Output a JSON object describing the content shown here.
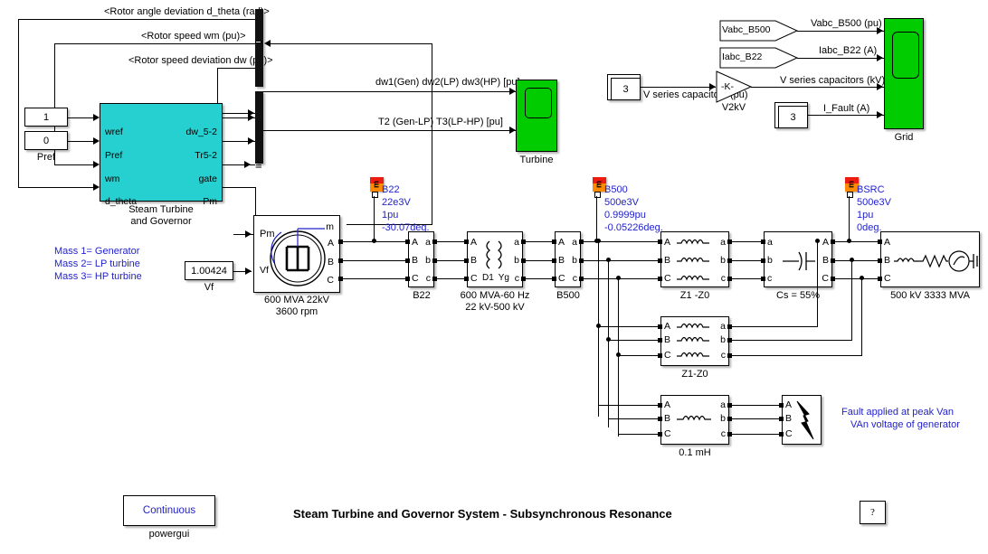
{
  "diagram": {
    "title": "Steam Turbine and Governor System - Subsynchronous Resonance",
    "tool": "simulink"
  },
  "signal_labels": {
    "rotor_angle_dev": "<Rotor angle deviation  d_theta (rad)>",
    "rotor_speed": "<Rotor speed  wm  (pu)>",
    "rotor_speed_dev": "<Rotor speed deviation  dw (pu)>",
    "dw_mux": "dw1(Gen)  dw2(LP)   dw3(HP)  [pu]",
    "torque_mux": "T2 (Gen-LP)  T3(LP-HP)  [pu]",
    "vabc_b500": "Vabc_B500 (pu)",
    "iabc_b22": "Iabc_B22 (A)",
    "vseries_kv": "V series capacitors (kV)",
    "vseries_pu": "V series capacitors (pu)",
    "i_fault": "I_Fault (A)"
  },
  "constants": {
    "wref": {
      "value": "1",
      "name": ""
    },
    "pref": {
      "value": "0",
      "name": "Pref"
    },
    "vf": {
      "value": "1.00424",
      "name": "Vf"
    },
    "vseries_gain_in": {
      "value": "3",
      "name": ""
    },
    "ifault_const": {
      "value": "3",
      "name": ""
    }
  },
  "governor_block": {
    "name_line1": "Steam Turbine",
    "name_line2": "and Governor",
    "inputs": [
      "wref",
      "Pref",
      "wm",
      "d_theta"
    ],
    "outputs": [
      "dw_5-2",
      "Tr5-2",
      "gate",
      "Pm"
    ],
    "color": "#26d0d0"
  },
  "gain_block": {
    "label": "-K-",
    "name": "V2kV"
  },
  "from_blocks": [
    {
      "label": "Vabc_B500"
    },
    {
      "label": "Iabc_B22"
    }
  ],
  "scopes": [
    {
      "name": "Turbine",
      "color": "#00cc00"
    },
    {
      "name": "Grid",
      "color": "#00cc00"
    }
  ],
  "generator": {
    "inputs": [
      "Pm",
      "Vf"
    ],
    "outputs": [
      "m",
      "A",
      "B",
      "C"
    ],
    "name_line1": "600 MVA 22kV",
    "name_line2": "3600 rpm"
  },
  "measurements": [
    {
      "icon": "m",
      "bus": "B22",
      "base": "22e3V",
      "magnitude": "1pu",
      "angle": "-30.07deg."
    },
    {
      "icon": "m",
      "bus": "B500",
      "base": "500e3V",
      "magnitude": "0.9999pu",
      "angle": "-0.05226deg."
    },
    {
      "icon": "m",
      "bus": "BSRC",
      "base": "500e3V",
      "magnitude": "1pu",
      "angle": "0deg."
    }
  ],
  "three_phase_blocks": {
    "b22": {
      "name": "B22",
      "left_ports": [
        "A",
        "B",
        "C"
      ],
      "right_ports": [
        "a",
        "b",
        "c"
      ]
    },
    "transformer": {
      "name_line1": "600 MVA-60 Hz",
      "name_line2": "22 kV-500 kV",
      "left_ports": [
        "A",
        "B",
        "C"
      ],
      "right_ports": [
        "a",
        "b",
        "c"
      ],
      "winding_left": "D1",
      "winding_right": "Yg"
    },
    "b500": {
      "name": "B500",
      "left_ports": [
        "A",
        "B",
        "C"
      ],
      "right_ports": [
        "a",
        "b",
        "c"
      ]
    },
    "line_upper": {
      "name": "Z1 -Z0",
      "left_ports": [
        "A",
        "B",
        "C"
      ],
      "right_ports": [
        "a",
        "b",
        "c"
      ]
    },
    "series_cap": {
      "name": "Cs = 55%",
      "left_ports": [
        "a",
        "b",
        "c"
      ],
      "right_ports": [
        "A",
        "B",
        "C"
      ]
    },
    "source": {
      "name": "500 kV 3333 MVA",
      "left_ports": [
        "A",
        "B",
        "C"
      ]
    },
    "line_lower": {
      "name": "Z1-Z0",
      "left_ports": [
        "A",
        "B",
        "C"
      ],
      "right_ports": [
        "a",
        "b",
        "c"
      ]
    },
    "fault_inductance": {
      "name": "0.1 mH",
      "left_ports": [
        "A",
        "B",
        "C"
      ],
      "right_ports": [
        "a",
        "b",
        "c"
      ]
    },
    "fault_breaker": {
      "left_ports": [
        "A",
        "B",
        "C"
      ]
    }
  },
  "annotations": {
    "mass_list": [
      "Mass 1= Generator",
      "Mass 2= LP turbine",
      "Mass 3= HP turbine"
    ],
    "fault_note": [
      "Fault applied at peak Van",
      "VAn voltage of generator"
    ]
  },
  "powergui": {
    "value": "Continuous",
    "name": "powergui"
  },
  "help_button": {
    "label": "?"
  },
  "colors": {
    "annotation_blue": "#2222cc",
    "block_cyan": "#26d0d0",
    "scope_green": "#00cc00",
    "measure_red": "#ee1b11",
    "measure_orange": "#ff8a00"
  }
}
